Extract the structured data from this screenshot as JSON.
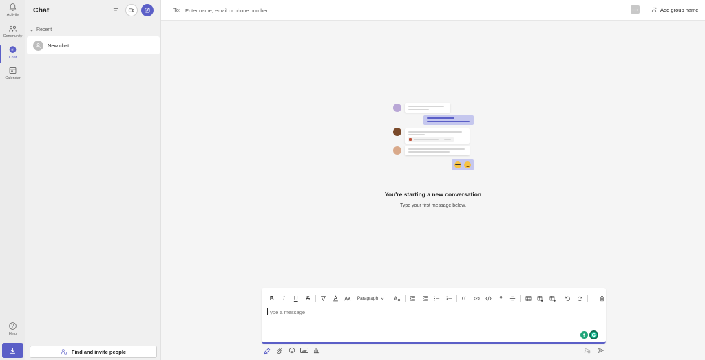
{
  "rail": {
    "items": [
      {
        "label": "Activity",
        "icon": "bell-icon"
      },
      {
        "label": "Community",
        "icon": "community-icon"
      },
      {
        "label": "Chat",
        "icon": "chat-icon",
        "active": true
      },
      {
        "label": "Calendar",
        "icon": "calendar-icon"
      }
    ],
    "help_label": "Help",
    "download_icon": "download-icon"
  },
  "list": {
    "title": "Chat",
    "recent_label": "Recent",
    "chats": [
      {
        "name": "New chat"
      }
    ],
    "find_button": "Find and invite people"
  },
  "header": {
    "to_label": "To:",
    "to_placeholder": "Enter name, email or phone number",
    "add_group_name": "Add group name"
  },
  "conversation": {
    "title": "You're starting a new conversation",
    "subtitle": "Type your first message below."
  },
  "compose": {
    "paragraph_label": "Paragraph",
    "placeholder": "Type a message",
    "gif_label": "GIF"
  },
  "colors": {
    "accent": "#5b5fc7",
    "rail_bg": "#ebebeb",
    "pane_bg": "#f0f0f0",
    "main_bg": "#f5f5f5"
  }
}
